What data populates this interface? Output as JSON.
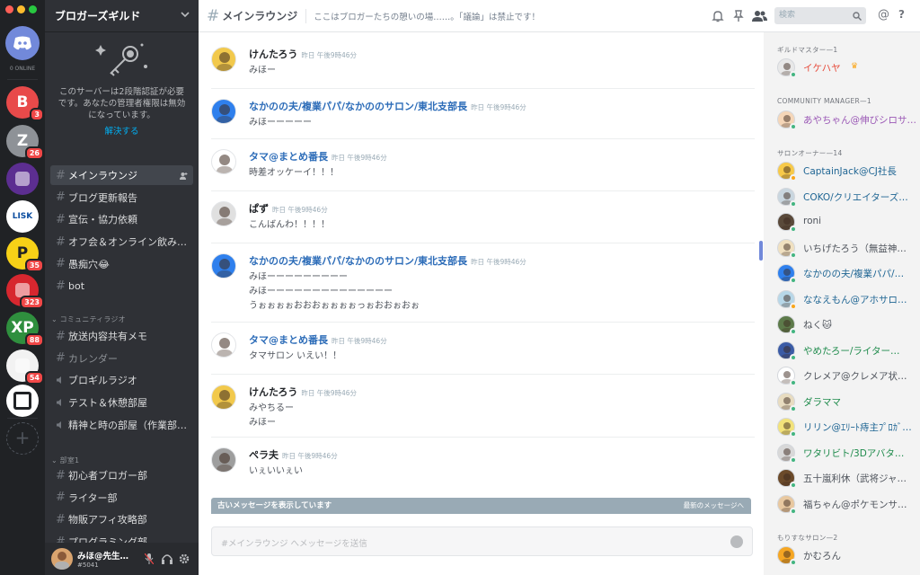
{
  "colors": {
    "online": "#43b581",
    "idle": "#faa61a",
    "offline": "#747f8d",
    "accent": "#7289da",
    "badge": "#f04747"
  },
  "rail": {
    "online_label": "0 ONLINE",
    "guilds": [
      {
        "letter": "B",
        "badge": "3",
        "bg": "#e84a4a"
      },
      {
        "letter": "Z",
        "badge": "26",
        "bg": "#8e9297"
      },
      {
        "letter": "",
        "badge": "",
        "bg": "#5c2e91",
        "icon": "eggplant-icon"
      },
      {
        "letter": "LISK",
        "badge": "",
        "bg": "#ffffff",
        "fg": "#0d4ea0"
      },
      {
        "letter": "P",
        "badge": "35",
        "bg": "#f7d117",
        "fg": "#202225"
      },
      {
        "letter": "",
        "badge": "323",
        "bg": "#d7272f",
        "icon": "dragon-icon"
      },
      {
        "letter": "XP",
        "badge": "88",
        "bg": "#2f8f3e"
      },
      {
        "letter": "",
        "badge": "54",
        "bg": "#f2f2f2",
        "icon": "flower-icon"
      },
      {
        "letter": "",
        "badge": "",
        "bg": "#ffffff",
        "icon": "brackets-icon"
      }
    ],
    "add_label": "+"
  },
  "sidebar": {
    "guild_name": "ブロガーズギルド",
    "auth_text": "このサーバーは2段階認証が必要です。あなたの管理者権限は無効になっています。",
    "auth_link": "解決する",
    "channels_top": [
      {
        "name": "メインラウンジ",
        "active": true
      },
      {
        "name": "ブログ更新報告"
      },
      {
        "name": "宣伝・協力依頼"
      },
      {
        "name": "オフ会＆オンライン飲み…"
      },
      {
        "name": "愚痴穴😂"
      },
      {
        "name": "bot"
      }
    ],
    "cat_radio": "コミュニティラジオ",
    "channels_radio": [
      {
        "name": "放送内容共有メモ",
        "type": "text"
      },
      {
        "name": "カレンダー",
        "type": "text",
        "dim": true
      },
      {
        "name": "ブロギルラジオ",
        "type": "voice"
      },
      {
        "name": "テスト＆休憩部屋",
        "type": "voice"
      },
      {
        "name": "精神と時の部屋（作業部…",
        "type": "voice"
      }
    ],
    "cat_club": "部室1",
    "channels_club": [
      {
        "name": "初心者ブロガー部"
      },
      {
        "name": "ライター部"
      },
      {
        "name": "物販アフィ攻略部"
      },
      {
        "name": "プログラミング部"
      }
    ],
    "user": {
      "name": "みほ@先生…",
      "tag": "#5041"
    }
  },
  "header": {
    "channel": "メインラウンジ",
    "topic": "ここはブロガーたちの憩いの場……。「議論」は禁止です！",
    "search_placeholder": "検索"
  },
  "messages": [
    {
      "author": "けんたろう",
      "blue": false,
      "time": "昨日 午後9時46分",
      "lines": [
        "みほー"
      ],
      "av": "#f2c94c"
    },
    {
      "author": "なかのの夫/複業パパ/なかののサロン/東北支部長",
      "blue": true,
      "time": "昨日 午後9時46分",
      "lines": [
        "みほーーーーー"
      ],
      "av": "#2f80ed"
    },
    {
      "author": "タマ@まとめ番長",
      "blue": true,
      "time": "昨日 午後9時46分",
      "lines": [
        "時差オッケーイ！！！"
      ],
      "av": "#ffffff"
    },
    {
      "author": "ぱず",
      "blue": false,
      "time": "昨日 午後9時46分",
      "lines": [
        "こんばんわ！！！！"
      ],
      "av": "#e0e0e0"
    },
    {
      "author": "なかのの夫/複業パパ/なかののサロン/東北支部長",
      "blue": true,
      "time": "昨日 午後9時46分",
      "lines": [
        "みほーーーーーーーーー",
        "みほーーーーーーーーーーーーーー",
        "うぉぉぉぉおおおぉぉぉぉっぉおおぉおぉ"
      ],
      "av": "#2f80ed"
    },
    {
      "author": "タマ@まとめ番長",
      "blue": true,
      "time": "昨日 午後9時46分",
      "lines": [
        "タマサロン いえい！！"
      ],
      "av": "#ffffff"
    },
    {
      "author": "けんたろう",
      "blue": false,
      "time": "昨日 午後9時46分",
      "lines": [
        "みやちるー",
        "みほー"
      ],
      "av": "#f2c94c"
    },
    {
      "author": "ペラ夫",
      "blue": false,
      "time": "昨日 午後9時46分",
      "lines": [
        "いぇいいぇい"
      ],
      "av": "#9e9e9e"
    }
  ],
  "old_messages_bar": {
    "label": "古いメッセージを表示しています",
    "jump": "最新のメッセージへ"
  },
  "composer": {
    "placeholder": "#メインラウンジ へメッセージを送信"
  },
  "members": {
    "groups": [
      {
        "title": "ギルドマスター—1",
        "items": [
          {
            "name": "イケハヤ",
            "color": "#e74c3c",
            "status": "online",
            "crown": true,
            "av": "#e8e8e8"
          }
        ]
      },
      {
        "title": "COMMUNITY MANAGER—1",
        "items": [
          {
            "name": "あやちゃん@伸びシロサ…",
            "color": "#9b59b6",
            "status": "online",
            "av": "#f5d6b8"
          }
        ]
      },
      {
        "title": "サロンオーナー—14",
        "items": [
          {
            "name": "CaptainJack@CJ社長",
            "color": "#206694",
            "status": "idle",
            "av": "#f7c948"
          },
          {
            "name": "COKO/クリエイターズ…",
            "color": "#206694",
            "status": "online",
            "av": "#c9d6df"
          },
          {
            "name": "roni",
            "color": "#4f545c",
            "status": "online",
            "av": "#5a4a3a"
          },
          {
            "name": "いちげたろう（無益神…",
            "color": "#4f545c",
            "status": "online",
            "av": "#f0e0c0"
          },
          {
            "name": "なかのの夫/複業パパ/…",
            "color": "#206694",
            "status": "online",
            "av": "#2f80ed"
          },
          {
            "name": "ななえもん@アホサロ…",
            "color": "#206694",
            "status": "idle",
            "av": "#b7d7e8"
          },
          {
            "name": "ねく🐱",
            "color": "#4f545c",
            "status": "online",
            "av": "#5d7a4a"
          },
          {
            "name": "やめたろー/ライター…",
            "color": "#1f8b4c",
            "status": "online",
            "av": "#3b5ba5"
          },
          {
            "name": "クレメア@クレメア状…",
            "color": "#4f545c",
            "status": "online",
            "av": "#ffffff"
          },
          {
            "name": "ダラママ",
            "color": "#1f8b4c",
            "status": "online",
            "av": "#e8dcc0"
          },
          {
            "name": "リリン@ｴﾘｰﾄ痔主ﾌﾟﾛｶﾞ…",
            "color": "#206694",
            "status": "online",
            "av": "#f2e27a"
          },
          {
            "name": "ワタリビト/3Dアバタ…",
            "color": "#1f8b4c",
            "status": "online",
            "av": "#d8d8d8"
          },
          {
            "name": "五十嵐利休（武将ジャ…",
            "color": "#4f545c",
            "status": "online",
            "av": "#6b4a2a"
          },
          {
            "name": "福ちゃん@ポケモンサ…",
            "color": "#4f545c",
            "status": "online",
            "av": "#e8c8a0"
          }
        ]
      },
      {
        "title": "もりすなサロン—2",
        "items": [
          {
            "name": "かむろん",
            "color": "#4f545c",
            "status": "online",
            "av": "#f5a623"
          }
        ]
      }
    ]
  }
}
